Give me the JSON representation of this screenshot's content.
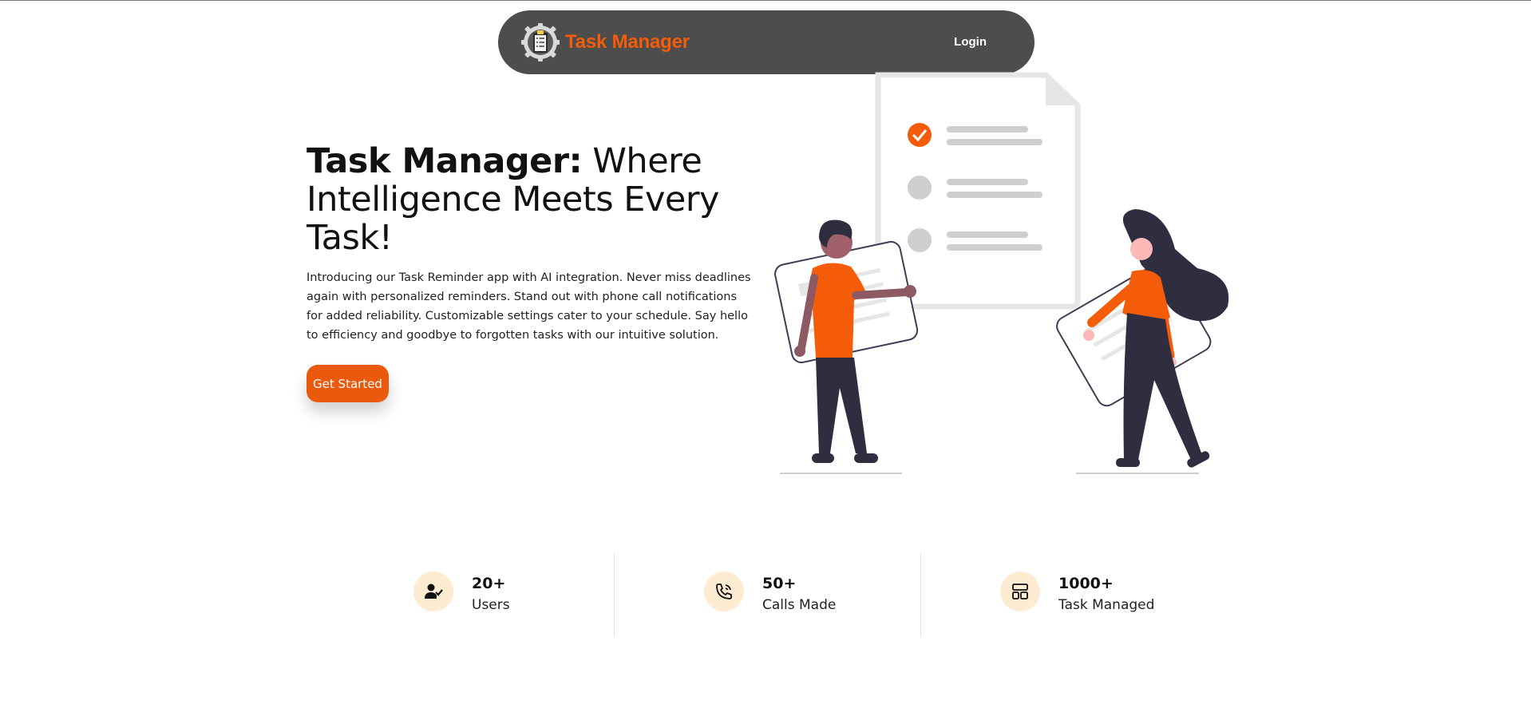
{
  "navbar": {
    "brand_name": "Task Manager",
    "login_label": "Login",
    "logo_icon": "clipboard-gear-logo"
  },
  "hero": {
    "title_strong": "Task Manager:",
    "title_rest": " Where Intelligence Meets Every Task!",
    "description": "Introducing our Task Reminder app with AI integration. Never miss deadlines again with personalized reminders. Stand out with phone call notifications for added reliability. Customizable settings cater to your schedule. Say hello to efficiency and goodbye to forgotten tasks with our intuitive solution.",
    "cta_label": "Get Started"
  },
  "stats": [
    {
      "value": "20+",
      "label": "Users",
      "icon": "user-check-icon"
    },
    {
      "value": "50+",
      "label": "Calls Made",
      "icon": "phone-call-icon"
    },
    {
      "value": "1000+",
      "label": "Task Managed",
      "icon": "layout-icon"
    }
  ],
  "colors": {
    "accent": "#f45c0a",
    "navbar_bg": "#4d4d4d",
    "stat_icon_bg": "#fdebd2",
    "figure_dark": "#2f2e41"
  }
}
